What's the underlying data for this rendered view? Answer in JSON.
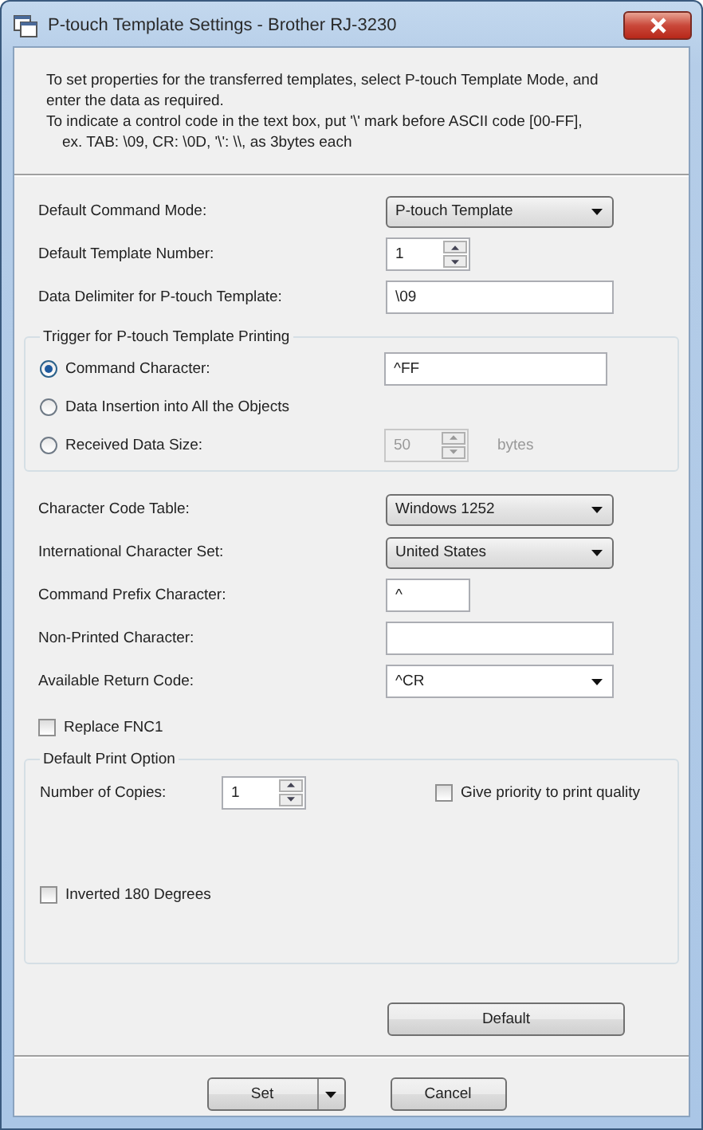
{
  "window": {
    "title": "P-touch Template Settings - Brother RJ-3230"
  },
  "intro": [
    "To set properties for the transferred templates, select P-touch Template Mode, and",
    "enter the data as required.",
    "To indicate a control code in the text box, put '\\' mark before ASCII code [00-FF],",
    "ex. TAB: \\09, CR: \\0D, '\\': \\\\, as 3bytes each"
  ],
  "settings": [
    {
      "label": "Default Command Mode:",
      "kind": "dropdown",
      "value": "P-touch Template"
    },
    {
      "label": "Default Template Number:",
      "kind": "spin",
      "value": "1"
    },
    {
      "label": "Data Delimiter for P-touch Template:",
      "kind": "text",
      "value": "\\09"
    }
  ],
  "trigger": {
    "title": "Trigger for P-touch Template Printing",
    "options": [
      {
        "label": "Command Character:",
        "selected": true,
        "field": {
          "kind": "text",
          "value": "^FF",
          "disabled": false
        }
      },
      {
        "label": "Data Insertion into All the Objects",
        "selected": false
      },
      {
        "label": "Received Data Size:",
        "selected": false,
        "field": {
          "kind": "spin",
          "value": "50",
          "disabled": true,
          "unit": "bytes"
        }
      }
    ]
  },
  "settings2": [
    {
      "label": "Character Code Table:",
      "kind": "dropdown",
      "value": "Windows 1252"
    },
    {
      "label": "International Character Set:",
      "kind": "dropdown",
      "value": "United States"
    },
    {
      "label": "Command Prefix Character:",
      "kind": "short",
      "value": "^"
    },
    {
      "label": "Non-Printed Character:",
      "kind": "text"
    },
    {
      "label": "Available Return Code:",
      "kind": "combo",
      "value": "^CR"
    }
  ],
  "replace_fnc1": {
    "label": "Replace FNC1",
    "checked": false
  },
  "print_option": {
    "title": "Default Print Option",
    "copies": {
      "label": "Number of Copies:",
      "value": "1"
    },
    "priority": {
      "label": "Give priority to print quality",
      "checked": false
    },
    "inverted": {
      "label": "Inverted 180 Degrees",
      "checked": false
    }
  },
  "buttons": {
    "default": "Default",
    "set": "Set",
    "cancel": "Cancel"
  }
}
